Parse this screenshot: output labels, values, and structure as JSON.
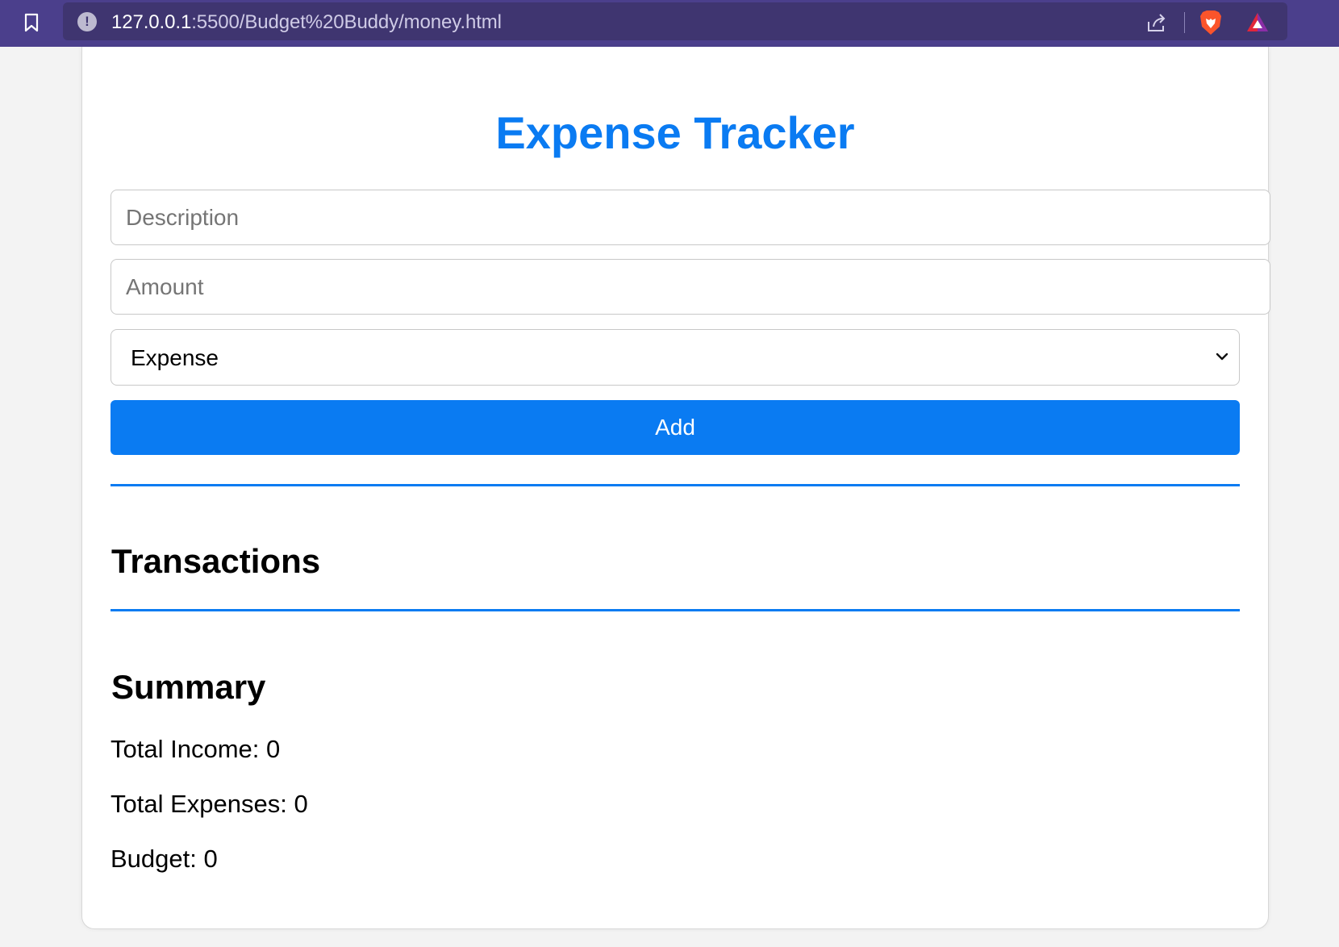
{
  "browser": {
    "url_host": "127.0.0.1",
    "url_path": ":5500/Budget%20Buddy/money.html"
  },
  "app": {
    "title": "Expense Tracker",
    "form": {
      "description_placeholder": "Description",
      "description_value": "",
      "amount_placeholder": "Amount",
      "amount_value": "",
      "type_selected": "Expense",
      "add_label": "Add"
    },
    "transactions_heading": "Transactions",
    "transactions": [],
    "summary": {
      "heading": "Summary",
      "total_income": "Total Income: 0",
      "total_expenses": "Total Expenses: 0",
      "budget": "Budget: 0"
    }
  },
  "colors": {
    "accent": "#0a7bf2",
    "chrome_bg": "#4b3f8c"
  },
  "icons": {
    "bookmark": "bookmark-icon",
    "site_info": "info-icon",
    "share": "share-icon",
    "brave_shields": "brave-lion-icon",
    "brave_rewards": "rewards-triangle-icon",
    "select_arrow": "chevron-down-icon"
  }
}
